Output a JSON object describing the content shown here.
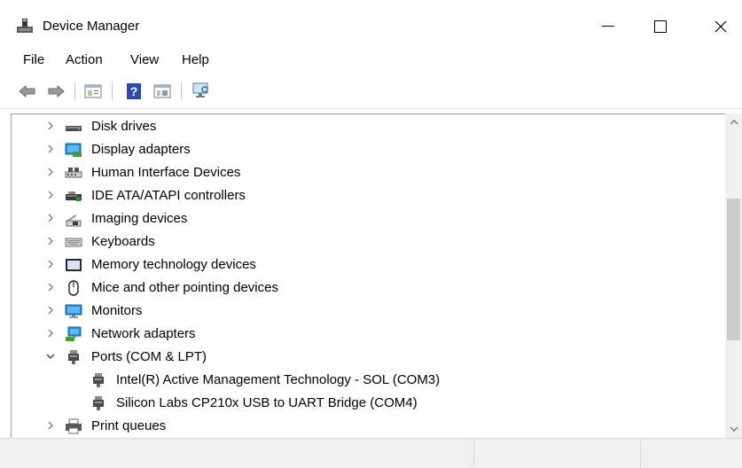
{
  "window": {
    "title": "Device Manager",
    "minimize_glyph": "—",
    "icon_name": "device-manager-icon"
  },
  "menu": [
    "File",
    "Action",
    "View",
    "Help"
  ],
  "toolbar": {
    "buttons": [
      "back-icon",
      "forward-icon",
      "properties-icon",
      "help-icon",
      "update-driver-icon",
      "scan-hardware-icon"
    ]
  },
  "tree": {
    "items": [
      {
        "label": "Disk drives",
        "expanded": false,
        "indent": 0,
        "icon": "disk-drive-icon"
      },
      {
        "label": "Display adapters",
        "expanded": false,
        "indent": 0,
        "icon": "display-adapter-icon"
      },
      {
        "label": "Human Interface Devices",
        "expanded": false,
        "indent": 0,
        "icon": "hid-icon"
      },
      {
        "label": "IDE ATA/ATAPI controllers",
        "expanded": false,
        "indent": 0,
        "icon": "ide-controller-icon"
      },
      {
        "label": "Imaging devices",
        "expanded": false,
        "indent": 0,
        "icon": "imaging-device-icon"
      },
      {
        "label": "Keyboards",
        "expanded": false,
        "indent": 0,
        "icon": "keyboard-icon"
      },
      {
        "label": "Memory technology devices",
        "expanded": false,
        "indent": 0,
        "icon": "memory-device-icon"
      },
      {
        "label": "Mice and other pointing devices",
        "expanded": false,
        "indent": 0,
        "icon": "mouse-icon"
      },
      {
        "label": "Monitors",
        "expanded": false,
        "indent": 0,
        "icon": "monitor-icon"
      },
      {
        "label": "Network adapters",
        "expanded": false,
        "indent": 0,
        "icon": "network-adapter-icon"
      },
      {
        "label": "Ports (COM & LPT)",
        "expanded": true,
        "indent": 0,
        "icon": "port-icon"
      },
      {
        "label": "Intel(R) Active Management Technology - SOL (COM3)",
        "expanded": null,
        "indent": 1,
        "icon": "port-icon"
      },
      {
        "label": "Silicon Labs CP210x USB to UART Bridge (COM4)",
        "expanded": null,
        "indent": 1,
        "icon": "port-icon"
      },
      {
        "label": "Print queues",
        "expanded": false,
        "indent": 0,
        "icon": "printer-icon"
      }
    ]
  },
  "colors": {
    "accent": "#1e90d8",
    "chevron": "#6b6b6b",
    "scroll_thumb": "#cdcdcd"
  }
}
